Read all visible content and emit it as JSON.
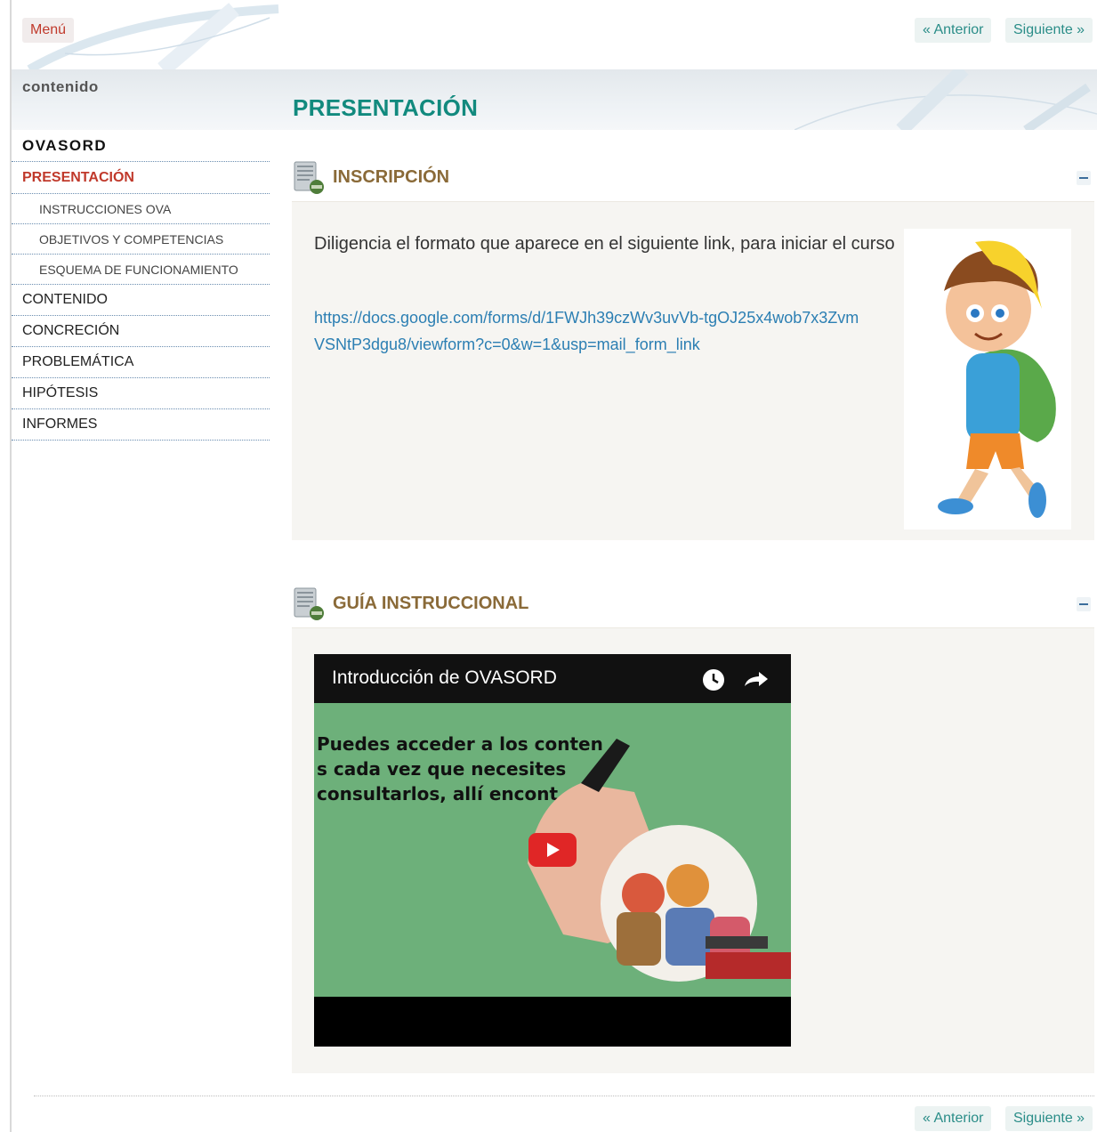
{
  "topnav": {
    "menu_label": "Menú",
    "prev_label": "« Anterior",
    "next_label": "Siguiente »"
  },
  "sidebar": {
    "title": "contenido",
    "items": [
      {
        "label": "OVASORD",
        "level": "top"
      },
      {
        "label": "PRESENTACIÓN",
        "level": "active"
      },
      {
        "label": "INSTRUCCIONES OVA",
        "level": "sub"
      },
      {
        "label": "OBJETIVOS Y COMPETENCIAS",
        "level": "sub"
      },
      {
        "label": "ESQUEMA DE FUNCIONAMIENTO",
        "level": "sub"
      },
      {
        "label": "CONTENIDO",
        "level": "main"
      },
      {
        "label": "CONCRECIÓN",
        "level": "main"
      },
      {
        "label": "PROBLEMÁTICA",
        "level": "main"
      },
      {
        "label": "HIPÓTESIS",
        "level": "main"
      },
      {
        "label": "INFORMES",
        "level": "main"
      }
    ]
  },
  "page": {
    "title": "PRESENTACIÓN"
  },
  "sections": [
    {
      "title": "INSCRIPCIÓN",
      "instruction": "Diligencia el formato que aparece en el siguiente link, para iniciar el curso",
      "link": "https://docs.google.com/forms/d/1FWJh39czWv3uvVb-tgOJ25x4wob7x3ZvmVSNtP3dgu8/viewform?c=0&w=1&usp=mail_form_link"
    },
    {
      "title": "GUÍA INSTRUCCIONAL",
      "video_title": "Introducción de OVASORD",
      "video_caption": "Puedes acceder a los conten   s cada vez que necesites consultarlos, allí encont"
    }
  ],
  "bottomnav": {
    "prev_label": "« Anterior",
    "next_label": "Siguiente »"
  },
  "colors": {
    "accent": "#128a7e",
    "active_nav": "#c0392b",
    "section_title": "#8a6a38",
    "link": "#2c7fb3"
  },
  "icons": [
    "notebook-icon",
    "collapse-icon",
    "clock-icon",
    "share-icon",
    "play-icon"
  ]
}
